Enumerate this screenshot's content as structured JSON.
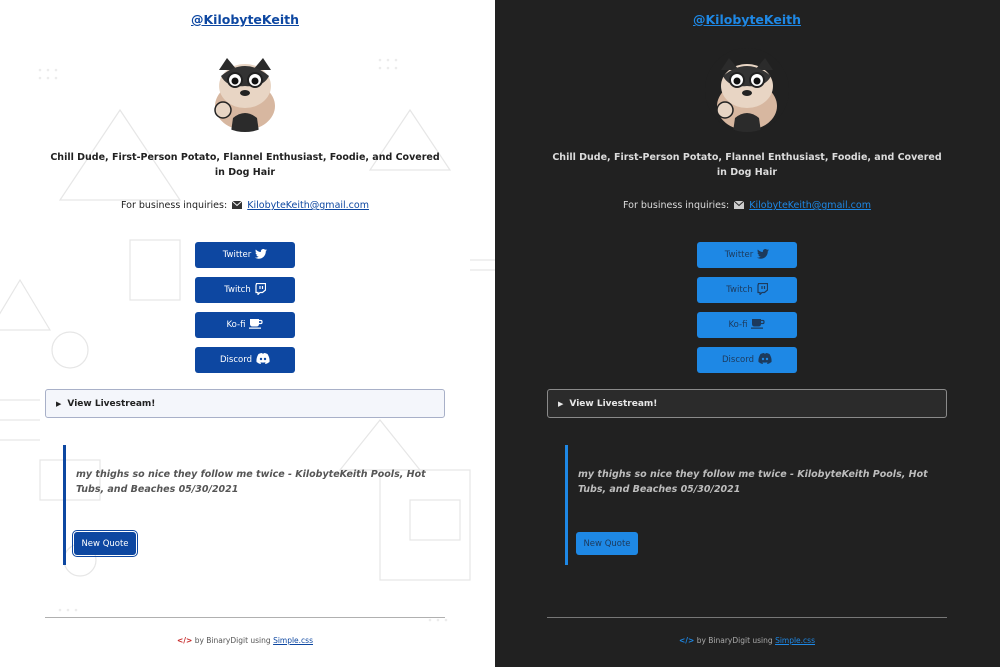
{
  "profile": {
    "handle": "@KilobyteKeith",
    "bio": "Chill Dude, First-Person Potato, Flannel Enthusiast, Foodie, and Covered in Dog Hair",
    "business_label": "For business inquiries:",
    "email": "KilobyteKeith@gmail.com"
  },
  "links": [
    {
      "label": "Twitter",
      "icon": "twitter-icon"
    },
    {
      "label": "Twitch",
      "icon": "twitch-icon"
    },
    {
      "label": "Ko-fi",
      "icon": "coffee-cup-icon"
    },
    {
      "label": "Discord",
      "icon": "discord-icon"
    }
  ],
  "livestream": {
    "label": "View Livestream!"
  },
  "quote": {
    "text": "my thighs so nice they follow me twice - KilobyteKeith Pools, Hot Tubs, and Beaches 05/30/2021",
    "button": "New Quote"
  },
  "footer": {
    "prefix": "by BinaryDigit using",
    "link": "Simple.css"
  },
  "colors": {
    "light_accent": "#0d47a1",
    "dark_accent": "#1e88e5",
    "dark_bg": "#212121"
  }
}
